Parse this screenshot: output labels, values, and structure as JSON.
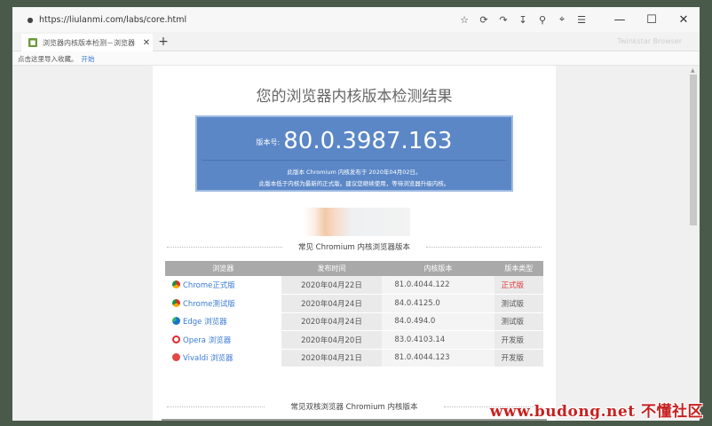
{
  "browser": {
    "url": "https://liulanmi.com/labs/core.html",
    "tab_title": "浏览器内核版本检测－浏览器",
    "brand": "Twinkstar Browser",
    "bookmark_hint": "点击这里导入收藏。",
    "bookmark_link": "开始",
    "icons": [
      "lock-icon",
      "star-icon",
      "refresh-icon",
      "undo-icon",
      "download-icon",
      "account-icon",
      "crop-icon",
      "menu-icon",
      "minimize-icon",
      "maximize-icon",
      "close-icon"
    ]
  },
  "page": {
    "title": "您的浏览器内核版本检测结果",
    "version_label": "版本号:",
    "version": "80.0.3987.163",
    "note1": "此版本 Chromium 内核发布于 2020年04月02日。",
    "note2": "此版本低于内核为最新的正式版。建议您继续使用，等待浏览器升级内核。",
    "section1": "常见 Chromium 内核浏览器版本",
    "section2": "常见双核浏览器 Chromium 内核版本",
    "table": {
      "headers": [
        "浏览器",
        "发布时间",
        "内核版本",
        "版本类型"
      ],
      "rows": [
        {
          "name": "Chrome正式版",
          "icon": "chrome-icon",
          "date": "2020年04月22日",
          "version": "81.0.4044.122",
          "type": "正式版",
          "type_color": "#e03a3a"
        },
        {
          "name": "Chrome测试版",
          "icon": "chrome-icon",
          "date": "2020年04月24日",
          "version": "84.0.4125.0",
          "type": "测试版",
          "type_color": "#555555"
        },
        {
          "name": "Edge 浏览器",
          "icon": "edge-icon",
          "date": "2020年04月24日",
          "version": "84.0.494.0",
          "type": "测试版",
          "type_color": "#555555"
        },
        {
          "name": "Opera 浏览器",
          "icon": "opera-icon",
          "date": "2020年04月20日",
          "version": "83.0.4103.14",
          "type": "开发版",
          "type_color": "#555555"
        },
        {
          "name": "Vivaldi 浏览器",
          "icon": "vivaldi-icon",
          "date": "2020年04月21日",
          "version": "81.0.4044.123",
          "type": "开发版",
          "type_color": "#555555"
        }
      ]
    }
  },
  "watermark": "www.budong.net 不懂社区"
}
